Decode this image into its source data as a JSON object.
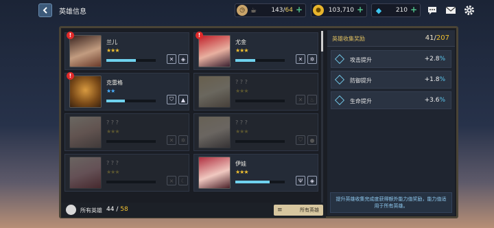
{
  "header": {
    "title": "英雄信息",
    "resources": [
      {
        "name": "stamina",
        "icon": "coffee-cup-icon",
        "value": "143",
        "max": "64"
      },
      {
        "name": "gold",
        "icon": "gold-coin-icon",
        "value": "103,710"
      },
      {
        "name": "gems",
        "icon": "diamond-icon",
        "value": "210"
      }
    ]
  },
  "heroes": [
    {
      "name": "兰儿",
      "stars": "★★★",
      "progress": 0.6,
      "locked": false,
      "warn": true
    },
    {
      "name": "尤金",
      "stars": "★★★",
      "progress": 0.4,
      "locked": false,
      "warn": true
    },
    {
      "name": "克雷格",
      "stars": "★★",
      "progress": 0.38,
      "locked": false,
      "warn": true
    },
    {
      "name": "? ? ?",
      "stars": "★★★",
      "progress": 0,
      "locked": true,
      "warn": false
    },
    {
      "name": "? ? ?",
      "stars": "★★★",
      "progress": 0,
      "locked": true,
      "warn": false
    },
    {
      "name": "? ? ?",
      "stars": "★★★",
      "progress": 0,
      "locked": true,
      "warn": false
    },
    {
      "name": "? ? ?",
      "stars": "★★★",
      "progress": 0,
      "locked": true,
      "warn": false
    },
    {
      "name": "伊娃",
      "stars": "★★★",
      "progress": 0.7,
      "locked": false,
      "warn": false
    }
  ],
  "footer": {
    "all_label": "所有英雄",
    "owned": "44",
    "total": "58",
    "filter_label": "所有英雄"
  },
  "collection": {
    "title": "英雄收集奖励",
    "current": "41",
    "total": "207",
    "bonuses": [
      {
        "label": "攻击提升",
        "value": "+2.8",
        "unit": "%"
      },
      {
        "label": "防御提升",
        "value": "+1.8",
        "unit": "%"
      },
      {
        "label": "生命提升",
        "value": "+3.6",
        "unit": "%"
      }
    ],
    "note": "提升英雄收集完成度获得额外能力值奖励，能力值适用于所有英雄。"
  },
  "colors": {
    "accent_gold": "#f0c030",
    "bar_cyan": "#6fd2ee",
    "warn_red": "#e02a2a"
  }
}
